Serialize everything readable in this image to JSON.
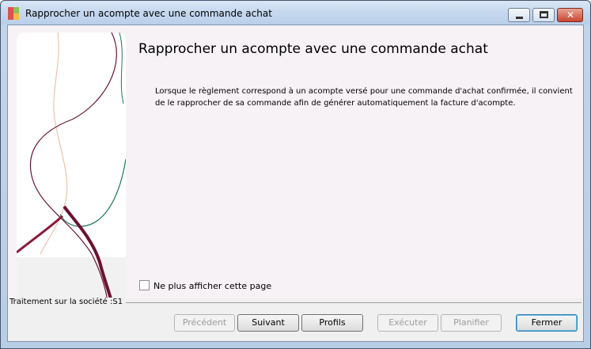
{
  "window": {
    "title": "Rapprocher un acompte avec une commande achat"
  },
  "page": {
    "title": "Rapprocher un acompte avec une commande achat",
    "description": "Lorsque le règlement correspond à un acompte versé pour une commande d'achat confirmée,  il convient de le rapprocher de sa commande afin de générer automatiquement la facture d'acompte."
  },
  "options": {
    "hide_page_label": "Ne plus afficher cette page",
    "hide_page_checked": false
  },
  "footer": {
    "company_label": "Traitement sur la société :S1"
  },
  "buttons": {
    "previous": "Précédent",
    "next": "Suivant",
    "profiles": "Profils",
    "execute": "Exécuter",
    "schedule": "Planifier",
    "close": "Fermer"
  },
  "colors": {
    "accent_maroon": "#6b1230",
    "accent_green": "#1f7a55",
    "accent_peach": "#e9b8a0"
  }
}
